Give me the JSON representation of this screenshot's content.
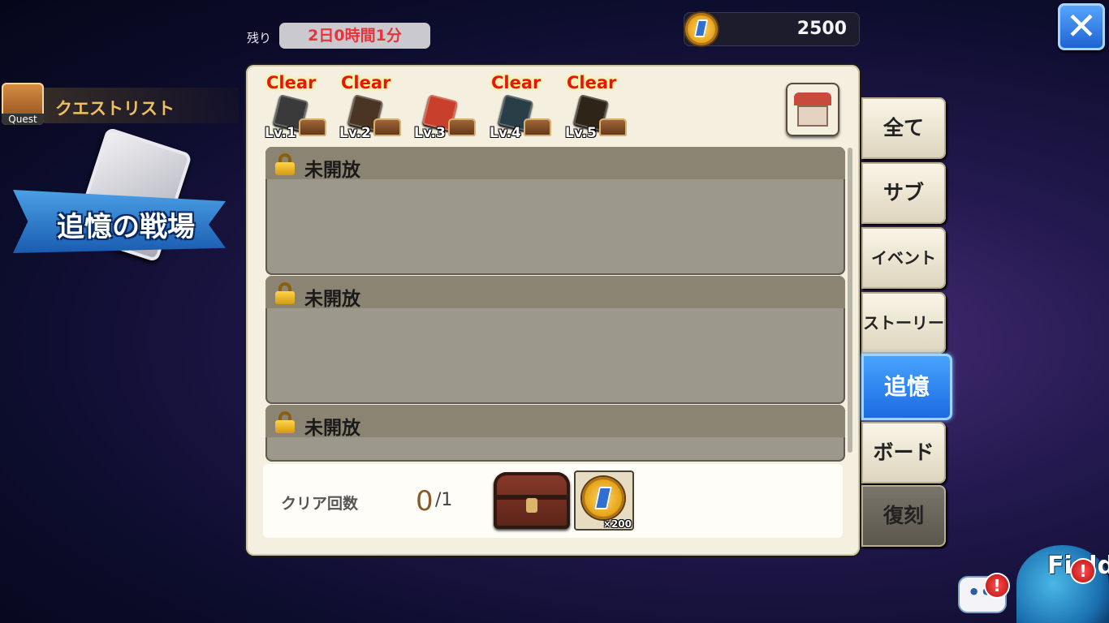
{
  "timer": {
    "label": "残り",
    "value": "2日0時間1分"
  },
  "currency": {
    "amount": "2500"
  },
  "close_label": "✕",
  "quest_list": {
    "icon_label": "Quest",
    "title": "クエストリスト"
  },
  "event": {
    "title": "追憶の戦場"
  },
  "levels": [
    {
      "clear": "Clear",
      "label": "Lv.1",
      "book_color": "#3a3a3a"
    },
    {
      "clear": "Clear",
      "label": "Lv.2",
      "book_color": "#4a3424"
    },
    {
      "clear": "",
      "label": "Lv.3",
      "book_color": "#c8402c"
    },
    {
      "clear": "Clear",
      "label": "Lv.4",
      "book_color": "#2a3e48"
    },
    {
      "clear": "Clear",
      "label": "Lv.5",
      "book_color": "#2e2418"
    }
  ],
  "rows": [
    {
      "label": "未開放"
    },
    {
      "label": "未開放"
    },
    {
      "label": "未開放"
    }
  ],
  "footer": {
    "clear_label": "クリア回数",
    "clear_count": "0",
    "clear_total": "/1",
    "reward_qty": "×200"
  },
  "tabs": [
    {
      "label": "全て",
      "state": "normal"
    },
    {
      "label": "サブ",
      "state": "normal"
    },
    {
      "label": "イベント",
      "state": "normal"
    },
    {
      "label": "ストーリー",
      "state": "normal"
    },
    {
      "label": "追憶",
      "state": "active"
    },
    {
      "label": "ボード",
      "state": "normal"
    },
    {
      "label": "復刻",
      "state": "disabled"
    }
  ],
  "chat": {
    "dots": "••",
    "alert": "!"
  },
  "field": {
    "label": "Field",
    "alert": "!"
  },
  "colors": {
    "accent_blue": "#1a68e0",
    "alert_red": "#e4141c",
    "timer_text": "#e8333a"
  }
}
